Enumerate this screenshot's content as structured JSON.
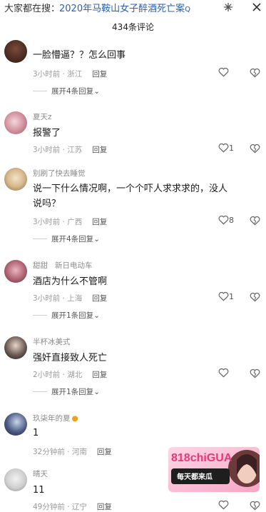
{
  "search": {
    "prefix": "大家都在搜：",
    "term": "2020年马鞍山女子醉酒死亡案",
    "glyph": "Q"
  },
  "top_icons": {
    "pin": "pin-icon",
    "close": "close-icon"
  },
  "comments_title": "434条评论",
  "comments": [
    {
      "user": "",
      "text": "一脸懵逼？？怎么回事",
      "time": "3小时前 · 浙江",
      "reply_label": "回复",
      "likes": "",
      "expand": "展开4条回复"
    },
    {
      "user": "夏天z",
      "text": "报警了",
      "time": "3小时前 · 江苏",
      "reply_label": "回复",
      "likes": "1",
      "expand": ""
    },
    {
      "user": "别刷了快去睡觉",
      "text": "说一下什么情况啊，一个个吓人求求求的，没人说吗？",
      "time": "3小时前 · 广西",
      "reply_label": "回复",
      "likes": "8",
      "expand": "展开4条回复"
    },
    {
      "user": "甜甜",
      "tag": "新日电动车",
      "text": "酒店为什么不管啊",
      "time": "3小时前 · 上海",
      "reply_label": "回复",
      "likes": "1",
      "expand": "展开1条回复"
    },
    {
      "user": "半杯冰美式",
      "text": "强奸直接致人死亡",
      "time": "2小时前 · 湖北",
      "reply_label": "回复",
      "likes": "",
      "expand": "展开1条回复"
    },
    {
      "user": "玖柒年的夏",
      "text": "1",
      "time": "32分钟前 · 河南",
      "reply_label": "回复",
      "likes": "",
      "expand": ""
    },
    {
      "user": "晴天",
      "text": "11",
      "time": "49分钟前 · 辽宁",
      "reply_label": "回复",
      "likes": "",
      "expand": ""
    }
  ],
  "ad": {
    "brand": "818chiGUA",
    "line1": "每天都来瓜",
    "line2": ""
  },
  "colors": {
    "link": "#2b5fb0",
    "meta": "#9a9a9a",
    "ad_pink": "#e23a7a"
  }
}
